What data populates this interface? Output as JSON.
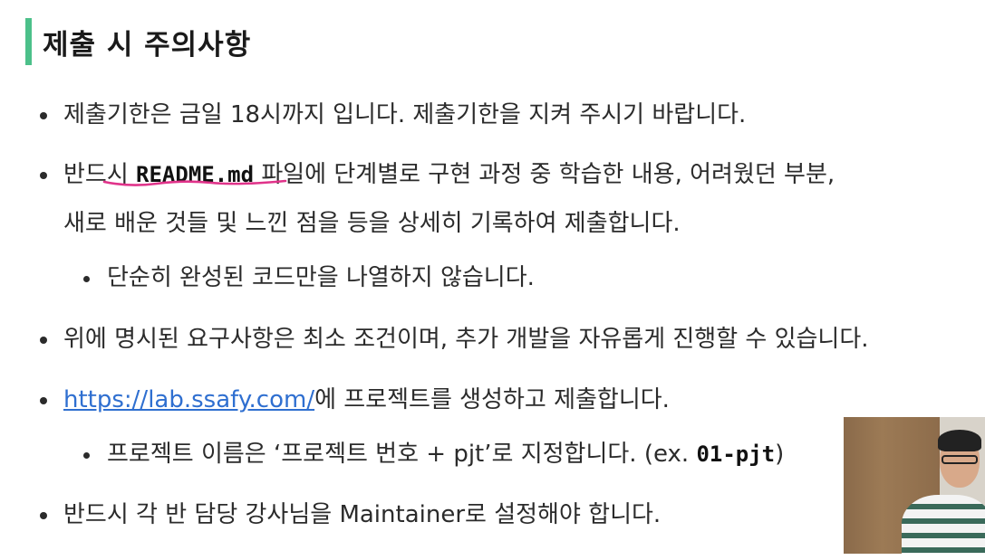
{
  "title": "제출 시 주의사항",
  "bullets": {
    "b1": "제출기한은 금일 18시까지 입니다. 제출기한을 지켜 주시기 바랍니다.",
    "b2_pre": "반드시 ",
    "b2_code": "README.md",
    "b2_post": " 파일에 단계별로 구현 과정 중 학습한 내용, 어려웠던 부분,",
    "b2_line2": "새로 배운 것들 및 느낀 점을 등을 상세히 기록하여 제출합니다.",
    "b2_sub": "단순히 완성된 코드만을 나열하지 않습니다.",
    "b3": "위에 명시된 요구사항은 최소 조건이며, 추가 개발을 자유롭게 진행할 수 있습니다.",
    "b4_link": "https://lab.ssafy.com/",
    "b4_post": "에 프로젝트를 생성하고 제출합니다.",
    "b4_sub_pre": "프로젝트 이름은 ‘프로젝트 번호 + pjt’로 지정합니다. (ex. ",
    "b4_sub_code": "01-pjt",
    "b4_sub_post": ")",
    "b5": "반드시 각 반 담당 강사님을 Maintainer로 설정해야 합니다."
  },
  "colors": {
    "accent": "#4cc08a",
    "link": "#2f6fd0",
    "annotation": "#e0338a"
  }
}
